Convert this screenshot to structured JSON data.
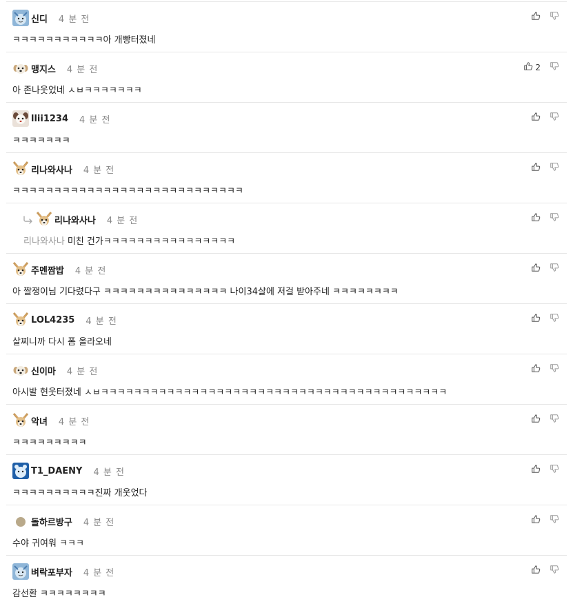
{
  "comments": [
    {
      "nick": "신디",
      "time": "4 분 전",
      "text": "ㅋㅋㅋㅋㅋㅋㅋㅋㅋㅋㅋ아 개빵터졌네",
      "avatar": "blue-character-avatar",
      "upvotes": ""
    },
    {
      "nick": "맹지스",
      "time": "4 분 전",
      "text": "아 존나웃었네 ㅅㅂㅋㅋㅋㅋㅋㅋㅋ",
      "avatar": "puppy-avatar",
      "upvotes": "2"
    },
    {
      "nick": "llii1234",
      "time": "4 분 전",
      "text": "ㅋㅋㅋㅋㅋㅋㅋ",
      "avatar": "cute-animal-avatar",
      "upvotes": ""
    },
    {
      "nick": "리나와사나",
      "time": "4 분 전",
      "text": "ㅋㅋㅋㅋㅋㅋㅋㅋㅋㅋㅋㅋㅋㅋㅋㅋㅋㅋㅋㅋㅋㅋㅋㅋㅋㅋㅋㅋ",
      "avatar": "chihuahua-avatar",
      "upvotes": ""
    },
    {
      "nick": "리나와사나",
      "time": "4 분 전",
      "mention": "리나와사나",
      "text": "미친 건가ㅋㅋㅋㅋㅋㅋㅋㅋㅋㅋㅋㅋㅋㅋㅋㅋ",
      "avatar": "chihuahua-avatar",
      "upvotes": "",
      "reply": true
    },
    {
      "nick": "주멘짬밥",
      "time": "4 분 전",
      "text": "아 짤쟁이님 기다렸다구 ㅋㅋㅋㅋㅋㅋㅋㅋㅋㅋㅋㅋㅋㅋㅋ 나이34살에 저걸 받아주네 ㅋㅋㅋㅋㅋㅋㅋㅋ",
      "avatar": "chihuahua-avatar",
      "upvotes": ""
    },
    {
      "nick": "LOL4235",
      "time": "4 분 전",
      "text": "살찌니까 다시 폼 올라오네",
      "avatar": "chihuahua-avatar",
      "upvotes": ""
    },
    {
      "nick": "신이마",
      "time": "4 분 전",
      "text": "아시발 현웃터졌네 ㅅㅂㅋㅋㅋㅋㅋㅋㅋㅋㅋㅋㅋㅋㅋㅋㅋㅋㅋㅋㅋㅋㅋㅋㅋㅋㅋㅋㅋㅋㅋㅋㅋㅋㅋㅋㅋㅋㅋㅋㅋㅋㅋㅋ",
      "avatar": "puppy-avatar",
      "upvotes": ""
    },
    {
      "nick": "악녀",
      "time": "4 분 전",
      "text": "ㅋㅋㅋㅋㅋㅋㅋㅋㅋ",
      "avatar": "chihuahua-avatar",
      "upvotes": ""
    },
    {
      "nick": "T1_DAENY",
      "time": "4 분 전",
      "text": "ㅋㅋㅋㅋㅋㅋㅋㅋㅋㅋ진짜 개웃었다",
      "avatar": "blue-bear-avatar",
      "upvotes": ""
    },
    {
      "nick": "돌하르방구",
      "time": "4 분 전",
      "text": "수야 귀여워 ㅋㅋㅋ",
      "avatar": "dot-avatar",
      "upvotes": ""
    },
    {
      "nick": "벼락포부자",
      "time": "4 분 전",
      "text": "감선환 ㅋㅋㅋㅋㅋㅋㅋㅋ",
      "avatar": "blue-character-avatar",
      "upvotes": ""
    }
  ],
  "icons": {
    "upvote": "thumbs-up-icon",
    "downvote": "thumbs-down-icon",
    "reply": "reply-arrow-icon"
  },
  "colors": {
    "text": "#222222",
    "muted": "#888888",
    "divider": "#e6e6e6"
  }
}
